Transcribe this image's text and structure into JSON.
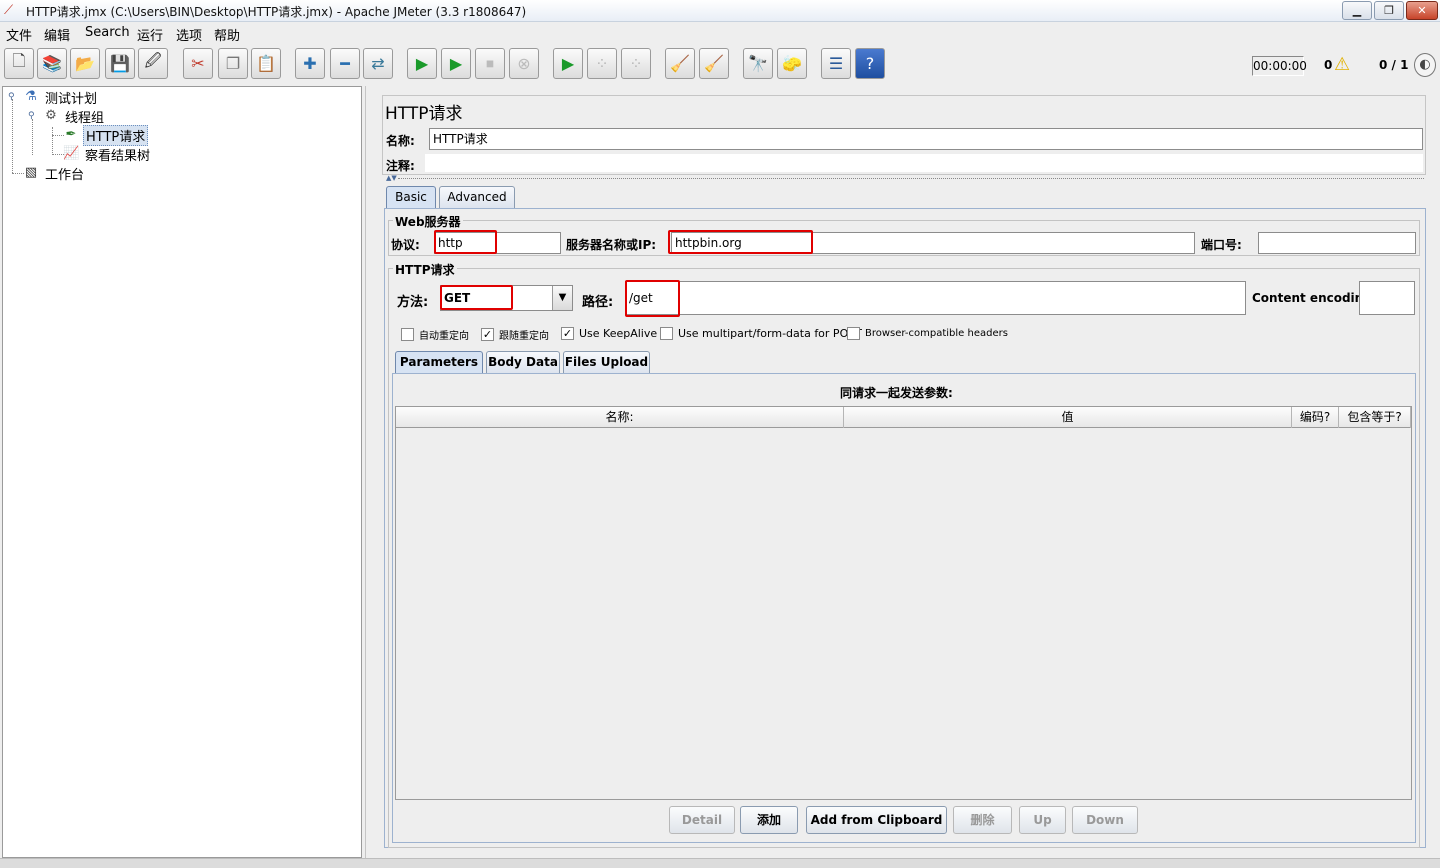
{
  "window": {
    "title": "HTTP请求.jmx (C:\\Users\\BIN\\Desktop\\HTTP请求.jmx) - Apache JMeter (3.3 r1808647)",
    "minimize_glyph": "▁",
    "maximize_glyph": "❐",
    "close_glyph": "✕"
  },
  "menu": [
    "文件",
    "编辑",
    "Search",
    "运行",
    "选项",
    "帮助"
  ],
  "toolbar": {
    "icons": [
      "new-icon",
      "templates-icon",
      "open-icon",
      "save-icon",
      "save-as-icon",
      "cut-icon",
      "copy-icon",
      "paste-icon",
      "expand-icon",
      "collapse-icon",
      "toggle-icon",
      "start-icon",
      "start-no-pause-icon",
      "stop-icon",
      "shutdown-icon",
      "remote-start-icon",
      "remote-stop-icon",
      "remote-shutdown-icon",
      "clear-icon",
      "clear-all-icon",
      "search-icon",
      "reset-search-icon",
      "function-helper-icon",
      "help-icon"
    ],
    "glyphs": [
      "🗋",
      "📚",
      "📂",
      "💾",
      "🖉",
      "✂",
      "❐",
      "📋",
      "✚",
      "━",
      "⇄",
      "▶",
      "▶",
      "⏹",
      "⊗",
      "▶",
      "⁘",
      "⁘",
      "🧹",
      "🧹",
      "🔭",
      "🧽",
      "☰",
      "?"
    ],
    "timer": "00:00:00",
    "error_count": "0",
    "threads": "0 / 1",
    "warn_glyph": "⚠",
    "globe_glyph": "◐"
  },
  "tree": {
    "test_plan": "测试计划",
    "thread_group": "线程组",
    "http_request": "HTTP请求",
    "result_tree": "察看结果树",
    "workbench": "工作台",
    "test_plan_icon": "⚗",
    "thread_group_icon": "⚙",
    "http_request_icon": "✒",
    "result_tree_icon": "📈",
    "workbench_icon": "▧"
  },
  "sampler": {
    "title": "HTTP请求",
    "name_label": "名称:",
    "name_value": "HTTP请求",
    "comment_label": "注释:",
    "collapse_glyph": "▲▼",
    "tabs": [
      "Basic",
      "Advanced"
    ],
    "web_server": {
      "group_title": "Web服务器",
      "protocol_label": "协议:",
      "protocol_value": "http",
      "server_label": "服务器名称或IP:",
      "server_value": "httpbin.org",
      "port_label": "端口号:",
      "port_value": ""
    },
    "http_request": {
      "group_title": "HTTP请求",
      "method_label": "方法:",
      "method_value": "GET",
      "dropdown_glyph": "▼",
      "path_label": "路径:",
      "path_value": "/get",
      "encoding_label": "Content encoding:",
      "encoding_value": ""
    },
    "options": [
      {
        "label": "自动重定向",
        "checked": false,
        "mark": ""
      },
      {
        "label": "跟随重定向",
        "checked": true,
        "mark": "✓"
      },
      {
        "label": "Use KeepAlive",
        "checked": true,
        "mark": "✓"
      },
      {
        "label": "Use multipart/form-data for POST",
        "checked": false,
        "mark": ""
      },
      {
        "label": "Browser-compatible headers",
        "checked": false,
        "mark": ""
      }
    ],
    "param_tabs": [
      "Parameters",
      "Body Data",
      "Files Upload"
    ],
    "params_title": "同请求一起发送参数:",
    "columns": [
      "名称:",
      "值",
      "编码?",
      "包含等于?"
    ],
    "buttons": {
      "detail": "Detail",
      "add": "添加",
      "add_clipboard": "Add from Clipboard",
      "delete": "删除",
      "up": "Up",
      "down": "Down"
    }
  }
}
